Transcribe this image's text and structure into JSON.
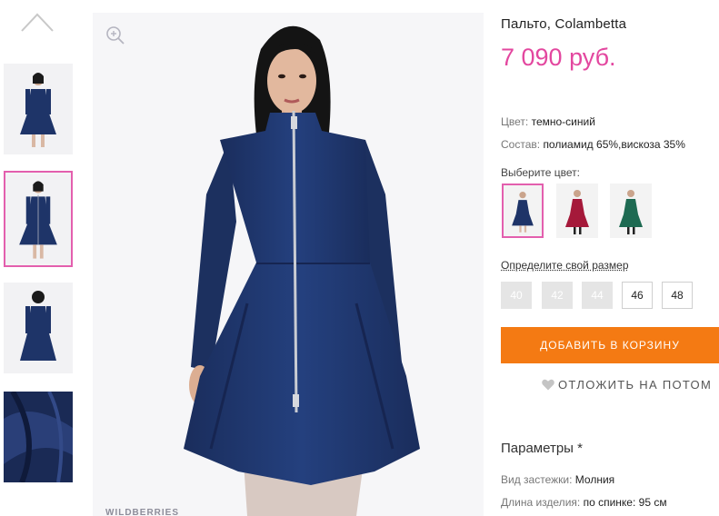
{
  "product": {
    "title": "Пальто, Colambetta",
    "price": "7 090 руб.",
    "color_label": "Цвет:",
    "color_value": "темно-синий",
    "composition_label": "Состав:",
    "composition_value": "полиамид 65%,вискоза 35%",
    "choose_color": "Выберите цвет:",
    "colors": [
      "темно-синий",
      "бордовый",
      "зеленый"
    ],
    "size_link": "Определите свой размер",
    "sizes": [
      {
        "label": "40",
        "available": false
      },
      {
        "label": "42",
        "available": false
      },
      {
        "label": "44",
        "available": false
      },
      {
        "label": "46",
        "available": true
      },
      {
        "label": "48",
        "available": true
      }
    ],
    "add_to_cart": "ДОБАВИТЬ В КОРЗИНУ",
    "save_later": "ОТЛОЖИТЬ НА ПОТОМ",
    "params_title": "Параметры *",
    "params": [
      {
        "label": "Вид застежки:",
        "value": "Молния"
      },
      {
        "label": "Длина изделия:",
        "value": "по спинке: 95 см"
      }
    ]
  },
  "gallery": {
    "watermark": "WILDBERRIES",
    "thumbnails": [
      "front-view",
      "front-view-selected",
      "back-view",
      "fabric-detail"
    ],
    "selected_index": 1
  },
  "colors": {
    "accent": "#e35fae",
    "price": "#e3479f",
    "button": "#f47a13",
    "coat_navy": "#1e3468",
    "coat_burgundy": "#a5193a",
    "coat_green": "#1e6a52"
  },
  "icons": [
    "chevron-up-icon",
    "zoom-in-icon",
    "heart-icon"
  ]
}
